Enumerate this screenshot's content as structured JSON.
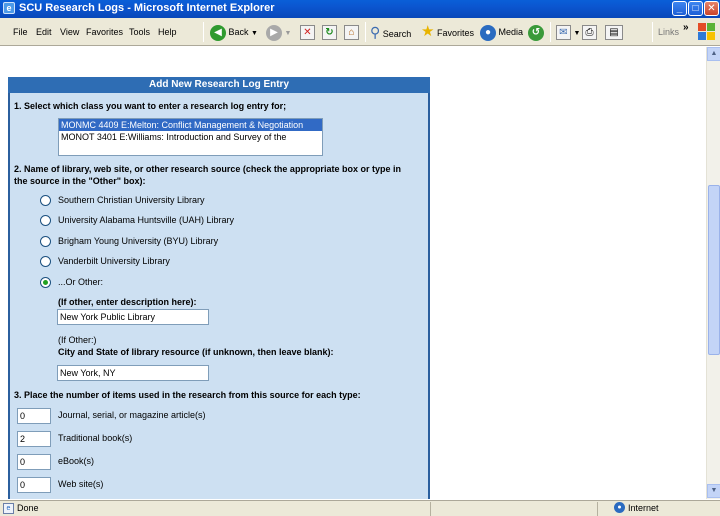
{
  "window": {
    "title": "SCU Research Logs - Microsoft Internet Explorer"
  },
  "menu": {
    "items": [
      "File",
      "Edit",
      "View",
      "Favorites",
      "Tools",
      "Help"
    ]
  },
  "toolbar": {
    "back_label": "Back",
    "search_label": "Search",
    "favorites_label": "Favorites",
    "media_label": "Media",
    "links_label": "Links"
  },
  "form": {
    "header": "Add New Research Log Entry",
    "q1_label": "1. Select which class you want to enter a research log entry for;",
    "classes": [
      {
        "label": "MONMC 4409 E:Melton: Conflict Management & Negotiation",
        "selected": true
      },
      {
        "label": "MONOT 3401 E:Williams: Introduction and Survey of the",
        "selected": false
      }
    ],
    "q2_label_line1": "2. Name of library, web site, or other research source (check the appropriate box or type in",
    "q2_label_line2": "the source in the \"Other\" box):",
    "sources": [
      {
        "label": "Southern Christian University Library",
        "checked": false
      },
      {
        "label": "University Alabama Huntsville (UAH) Library",
        "checked": false
      },
      {
        "label": "Brigham Young University (BYU) Library",
        "checked": false
      },
      {
        "label": "Vanderbilt University Library",
        "checked": false
      },
      {
        "label": "...Or Other:",
        "checked": true
      }
    ],
    "other_desc_label": "(If other, enter description here):",
    "other_desc_value": "New York Public Library",
    "if_other_label": "(If Other:)",
    "city_state_label": "City and State of library resource (if unknown, then leave blank):",
    "city_state_value": "New York, NY",
    "q3_label": "3. Place the number of items used in the research from this source for each type:",
    "item_counts": [
      {
        "value": "0",
        "label": "Journal, serial, or magazine article(s)"
      },
      {
        "value": "2",
        "label": "Traditional book(s)"
      },
      {
        "value": "0",
        "label": "eBook(s)"
      },
      {
        "value": "0",
        "label": "Web site(s)"
      }
    ]
  },
  "status": {
    "left": "Done",
    "zone": "Internet"
  },
  "colors": {
    "panel_bg": "#cde0f2",
    "panel_header": "#2e6db4",
    "title_bar": "#0b55cf",
    "selection": "#316ac5"
  }
}
